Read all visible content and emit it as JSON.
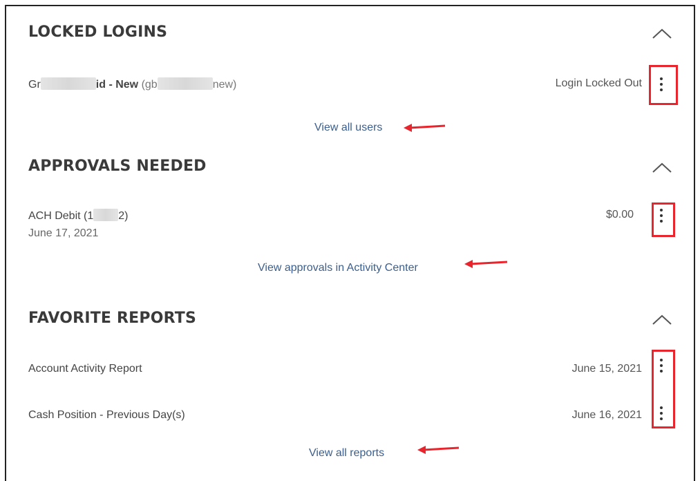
{
  "sections": {
    "locked": {
      "title": "LOCKED LOGINS",
      "row": {
        "name_start": "Gr",
        "name_end": "id - New",
        "user_open": "(gb",
        "user_close": "new)",
        "status": "Login Locked Out"
      },
      "link": "View all users"
    },
    "approvals": {
      "title": "APPROVALS NEEDED",
      "row": {
        "label_start": "ACH Debit (1",
        "label_end": "2)",
        "date": "June 17, 2021",
        "amount": "$0.00"
      },
      "link": "View approvals in Activity Center"
    },
    "reports": {
      "title": "FAVORITE REPORTS",
      "items": [
        {
          "label": "Account Activity Report",
          "date": "June 15, 2021"
        },
        {
          "label": "Cash Position - Previous Day(s)",
          "date": "June 16, 2021"
        }
      ],
      "link": "View all reports"
    }
  },
  "icons": {
    "collapse": "chevron-up-icon",
    "menu": "kebab-menu-icon",
    "annotation_arrow": "red-arrow-icon"
  },
  "colors": {
    "highlight": "#e8242c",
    "link": "#3b5e8c",
    "title": "#3a3a3a"
  }
}
